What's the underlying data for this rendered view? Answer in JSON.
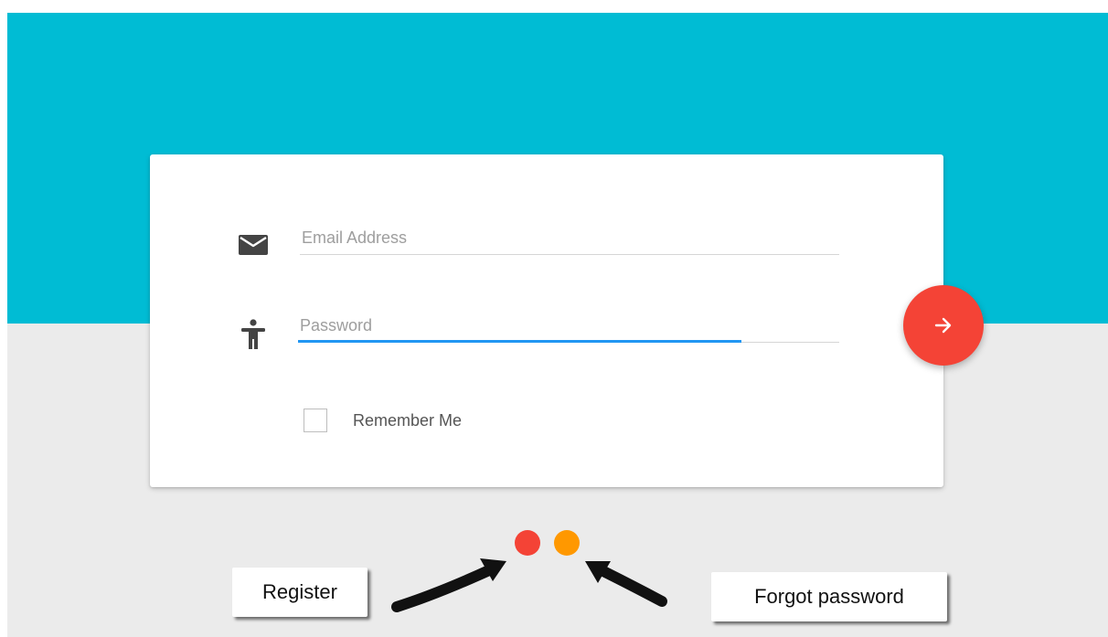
{
  "colors": {
    "hero": "#00bcd4",
    "background": "#ebebeb",
    "submit": "#f44336",
    "active_underline": "#2196f3",
    "register_dot": "#f44336",
    "forgot_dot": "#ff9800"
  },
  "login_form": {
    "email": {
      "icon": "envelope-icon",
      "value": "",
      "placeholder": "Email Address"
    },
    "password": {
      "icon": "accessibility-person-icon",
      "value": "",
      "placeholder": "Password"
    },
    "remember_me": {
      "label": "Remember Me",
      "checked": false
    },
    "submit": {
      "icon": "arrow-right-icon"
    }
  },
  "annotations": {
    "register_label": "Register",
    "forgot_password_label": "Forgot password"
  }
}
